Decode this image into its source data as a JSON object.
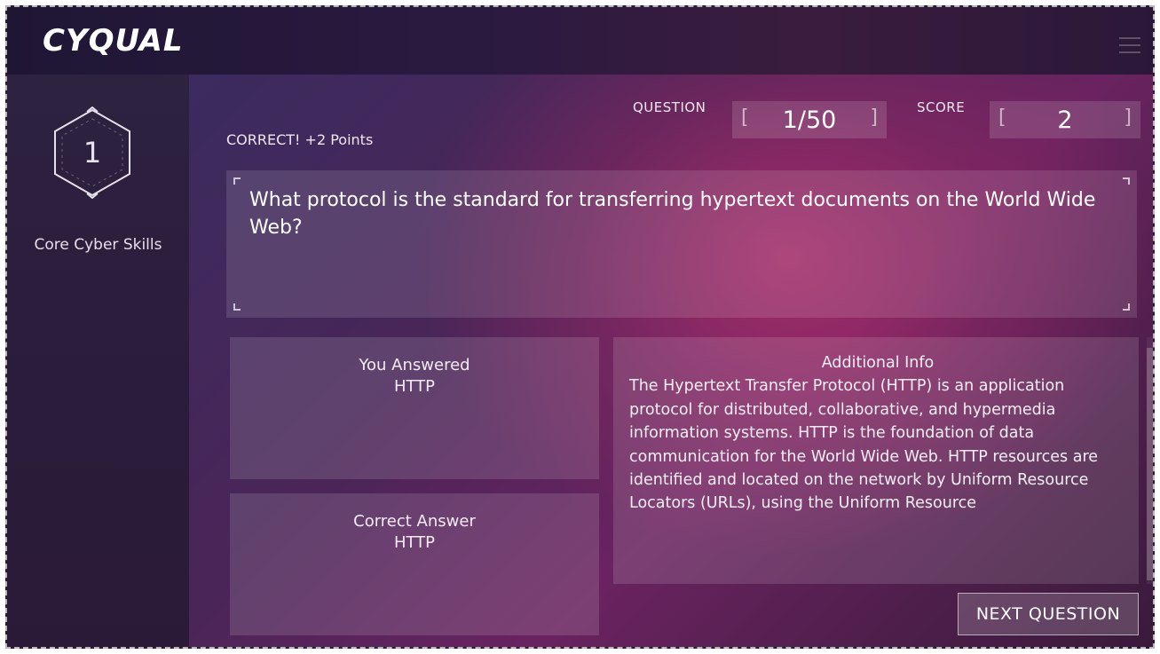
{
  "app": {
    "logo": "CYQUAL"
  },
  "sidebar": {
    "module_number": "1",
    "module_name": "Core Cyber Skills"
  },
  "header": {
    "question_label": "QUESTION",
    "question_value": "1/50",
    "score_label": "SCORE",
    "score_value": "2"
  },
  "feedback": "CORRECT! +2 Points",
  "question_text": "What protocol is the standard for transferring hypertext documents on the World Wide Web?",
  "answered": {
    "label": "You Answered",
    "value": "HTTP"
  },
  "correct": {
    "label": "Correct Answer",
    "value": "HTTP"
  },
  "info": {
    "title": "Additional Info",
    "text": "The Hypertext Transfer Protocol (HTTP) is an application protocol for distributed, collaborative, and hypermedia information systems. HTTP is the foundation of data communication for the World Wide Web.  HTTP resources are identified and located on the network by Uniform Resource Locators (URLs), using the Uniform Resource"
  },
  "next_button": "NEXT QUESTION",
  "icons": [
    "hexagon-icon",
    "menu-icon"
  ]
}
